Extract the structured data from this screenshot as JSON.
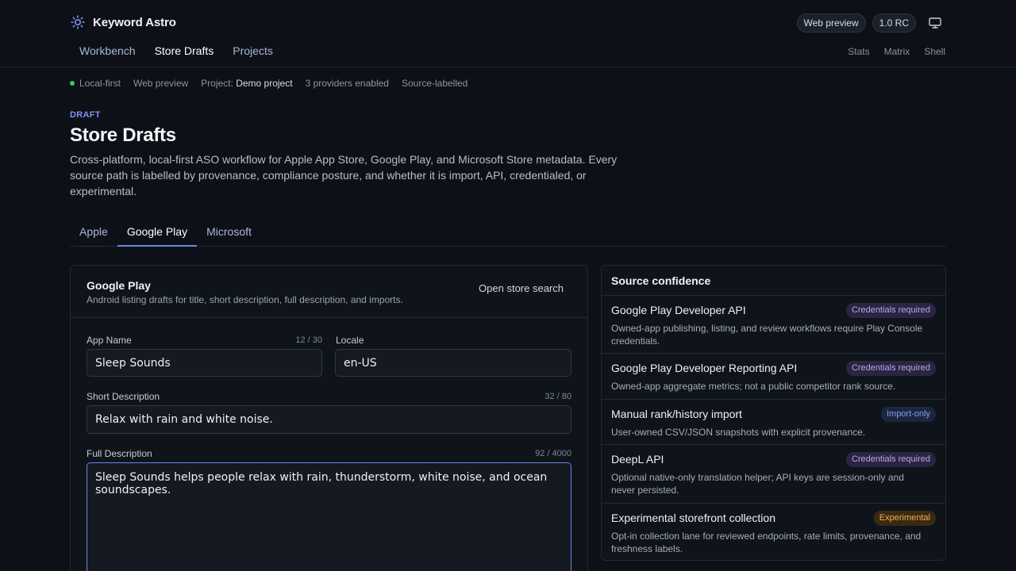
{
  "app": {
    "name": "Keyword Astro"
  },
  "top_right": {
    "pill_preview": "Web preview",
    "pill_version": "1.0 RC"
  },
  "main_nav": [
    {
      "label": "Workbench"
    },
    {
      "label": "Store Drafts"
    },
    {
      "label": "Projects"
    }
  ],
  "sub_nav": [
    {
      "label": "Stats"
    },
    {
      "label": "Matrix"
    },
    {
      "label": "Shell"
    }
  ],
  "status": {
    "local": "Local-first",
    "web": "Web preview",
    "project_label": "Project:",
    "project_value": "Demo project",
    "providers": "3 providers enabled",
    "source": "Source-labelled"
  },
  "page": {
    "eyebrow": "DRAFT",
    "title": "Store Drafts",
    "description": "Cross-platform, local-first ASO workflow for Apple App Store, Google Play, and Microsoft Store metadata. Every source path is labelled by provenance, compliance posture, and whether it is import, API, credentialed, or experimental."
  },
  "store_tabs": [
    {
      "label": "Apple"
    },
    {
      "label": "Google Play"
    },
    {
      "label": "Microsoft"
    }
  ],
  "draft_card": {
    "title": "Google Play",
    "subtitle": "Android listing drafts for title, short description, full description, and imports.",
    "open_search": "Open store search",
    "app_name": {
      "label": "App Name",
      "count": "12 / 30",
      "value": "Sleep Sounds"
    },
    "locale": {
      "label": "Locale",
      "value": "en-US"
    },
    "short_desc": {
      "label": "Short Description",
      "count": "32 / 80",
      "value": "Relax with rain and white noise."
    },
    "full_desc": {
      "label": "Full Description",
      "count": "92 / 4000",
      "value": "Sleep Sounds helps people relax with rain, thunderstorm, white noise, and ocean soundscapes."
    }
  },
  "source_card": {
    "title": "Source confidence",
    "sources": [
      {
        "name": "Google Play Developer API",
        "badge": "Credentials required",
        "desc": "Owned-app publishing, listing, and review workflows require Play Console credentials."
      },
      {
        "name": "Google Play Developer Reporting API",
        "badge": "Credentials required",
        "desc": "Owned-app aggregate metrics; not a public competitor rank source."
      },
      {
        "name": "Manual rank/history import",
        "badge": "Import-only",
        "desc": "User-owned CSV/JSON snapshots with explicit provenance."
      },
      {
        "name": "DeepL API",
        "badge": "Credentials required",
        "desc": "Optional native-only translation helper; API keys are session-only and never persisted."
      },
      {
        "name": "Experimental storefront collection",
        "badge": "Experimental",
        "desc": "Opt-in collection lane for reviewed endpoints, rate limits, provenance, and freshness labels."
      }
    ]
  },
  "colors": {
    "accent": "#6b86e8",
    "background": "#0d1017",
    "status_dot": "#3fbf74"
  }
}
